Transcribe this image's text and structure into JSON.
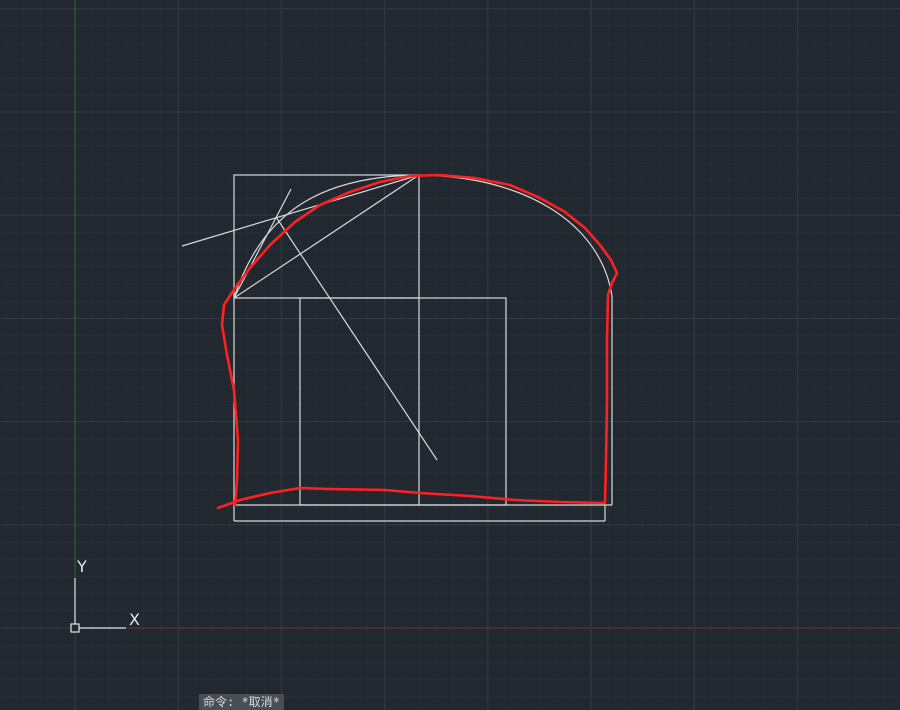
{
  "ucs_icon": {
    "x_label": "X",
    "y_label": "Y"
  },
  "command_line": {
    "text": "命令: *取消*"
  },
  "colors": {
    "background": "#212830",
    "grid_minor": "#2a313a",
    "grid_major": "#333b45",
    "x_axis": "#7a2a2a",
    "y_axis": "#2f6a2f",
    "geometry": "#d9d9d9",
    "markup_stroke": "#ff2020"
  }
}
